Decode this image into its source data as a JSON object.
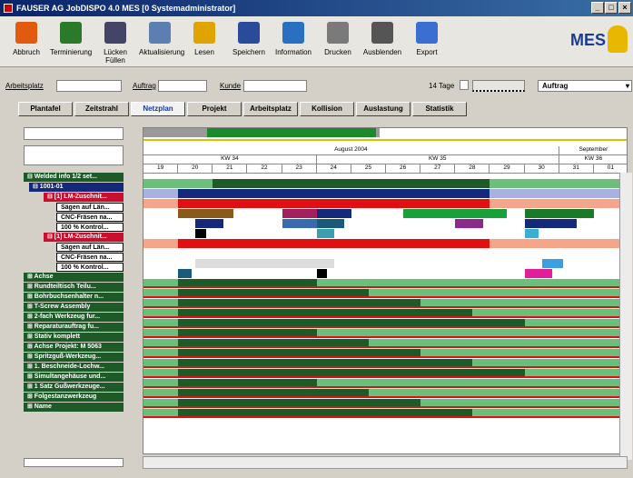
{
  "window": {
    "title": "FAUSER AG JobDISPO 4.0 MES  [0 Systemadministrator]",
    "controls": [
      "_",
      "□",
      "×"
    ]
  },
  "toolbar": {
    "items": [
      {
        "label": "Abbruch",
        "icon": "abort-icon",
        "color": "#e25a10"
      },
      {
        "label": "Terminierung",
        "icon": "schedule-icon",
        "color": "#2a7a2a"
      },
      {
        "label": "Lücken Füllen",
        "icon": "fill-gaps-icon",
        "color": "#446"
      },
      {
        "label": "Aktualisierung",
        "icon": "refresh-icon",
        "color": "#5a7fb0"
      },
      {
        "label": "Lesen",
        "icon": "folder-icon",
        "color": "#e0a400"
      },
      {
        "label": "Speichern",
        "icon": "save-icon",
        "color": "#2a4a9a"
      },
      {
        "label": "Information",
        "icon": "info-icon",
        "color": "#2a70c0"
      },
      {
        "label": "Drucken",
        "icon": "print-icon",
        "color": "#7a7a7a"
      },
      {
        "label": "Ausblenden",
        "icon": "hide-icon",
        "color": "#555"
      },
      {
        "label": "Export",
        "icon": "export-icon",
        "color": "#3a6ed0"
      }
    ],
    "logo": "MES"
  },
  "filter": {
    "arbeitsplatz_label": "Arbeitsplatz",
    "auftrag_label": "Auftrag",
    "kunde_label": "Kunde",
    "range_label": "14 Tage",
    "mode_value": "Auftrag"
  },
  "tabs": [
    "Plantafel",
    "Zeitstrahl",
    "Netzplan",
    "Projekt",
    "Arbeitsplatz",
    "Kollision",
    "Auslastung",
    "Statistik"
  ],
  "active_tab": "Netzplan",
  "timeline": {
    "month_left": "August 2004",
    "month_right": "September",
    "weeks": [
      "KW 34",
      "KW 35",
      "KW 36"
    ],
    "days": [
      "19",
      "20",
      "21",
      "22",
      "23",
      "24",
      "25",
      "26",
      "27",
      "28",
      "29",
      "30",
      "31",
      "01"
    ]
  },
  "tree": [
    {
      "label": "Welded info 1/2 set...",
      "style": "g",
      "indent": 0,
      "expander": "minus"
    },
    {
      "label": "1001-01",
      "style": "b",
      "indent": 6,
      "expander": "minus"
    },
    {
      "label": "[1] LM-Zuschnit...",
      "style": "r",
      "indent": 22,
      "expander": "minus"
    },
    {
      "label": "Sägen auf Län...",
      "style": "w",
      "indent": 36
    },
    {
      "label": "CNC-Fräsen na...",
      "style": "w",
      "indent": 36
    },
    {
      "label": "100 % Kontrol...",
      "style": "w",
      "indent": 36
    },
    {
      "label": "[1] LM-Zuschnit...",
      "style": "r",
      "indent": 22,
      "expander": "minus"
    },
    {
      "label": "Sägen auf Län...",
      "style": "w",
      "indent": 36
    },
    {
      "label": "CNC-Fräsen na...",
      "style": "w",
      "indent": 36
    },
    {
      "label": "100 % Kontrol...",
      "style": "w",
      "indent": 36
    },
    {
      "label": "Achse",
      "style": "g",
      "indent": 0,
      "expander": "plus"
    },
    {
      "label": "Rundteiltisch Teilu...",
      "style": "g",
      "indent": 0,
      "expander": "plus"
    },
    {
      "label": "Bohrbuchsenhalter n...",
      "style": "g",
      "indent": 0,
      "expander": "plus"
    },
    {
      "label": "T-Screw Assembly",
      "style": "g",
      "indent": 0,
      "expander": "plus"
    },
    {
      "label": "2-fach Werkzeug fur...",
      "style": "g",
      "indent": 0,
      "expander": "plus"
    },
    {
      "label": "Reparaturauftrag fu...",
      "style": "g",
      "indent": 0,
      "expander": "plus"
    },
    {
      "label": "Stativ komplett",
      "style": "g",
      "indent": 0,
      "expander": "plus"
    },
    {
      "label": "Achse Projekt: M 5063",
      "style": "g",
      "indent": 0,
      "expander": "plus"
    },
    {
      "label": "Spritzguß-Werkzeug...",
      "style": "g",
      "indent": 0,
      "expander": "plus"
    },
    {
      "label": "1. Beschneide-Lochw...",
      "style": "g",
      "indent": 0,
      "expander": "plus"
    },
    {
      "label": "Simultangehäuse und...",
      "style": "g",
      "indent": 0,
      "expander": "plus"
    },
    {
      "label": "1 Satz Gußwerkzeuge...",
      "style": "g",
      "indent": 0,
      "expander": "plus"
    },
    {
      "label": "Folgestanzwerkzeug",
      "style": "g",
      "indent": 0,
      "expander": "plus"
    },
    {
      "label": "Name",
      "style": "g",
      "indent": 0,
      "expander": "plus"
    }
  ],
  "colors": {
    "dark_green": "#1e5a28",
    "light_green": "#6cbf7a",
    "navy": "#14297a",
    "red": "#e01010",
    "salmon": "#f5a58a",
    "lavender": "#aab0e0"
  }
}
